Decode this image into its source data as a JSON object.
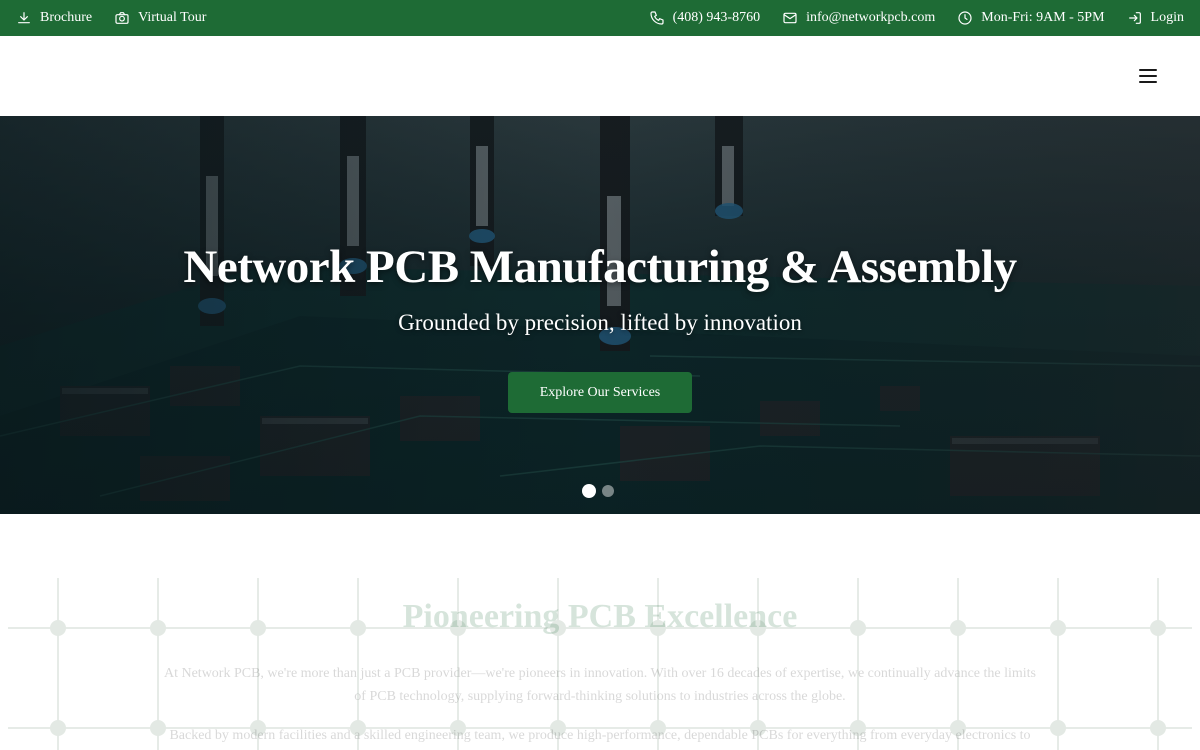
{
  "topbar": {
    "brochure": "Brochure",
    "virtual_tour": "Virtual Tour",
    "phone": "(408) 943-8760",
    "email": "info@networkpcb.com",
    "hours": "Mon-Fri: 9AM - 5PM",
    "login": "Login"
  },
  "hero": {
    "title": "Network PCB Manufacturing & Assembly",
    "subtitle": "Grounded by precision, lifted by innovation",
    "cta": "Explore Our Services",
    "slides": 2,
    "active_slide": 1
  },
  "section": {
    "title": "Pioneering PCB Excellence",
    "paragraph1": "At Network PCB, we're more than just a PCB provider—we're pioneers in innovation. With over 16 decades of expertise, we continually advance the limits of PCB technology, supplying forward-thinking solutions to industries across the globe.",
    "paragraph2": "Backed by modern facilities and a skilled engineering team, we produce high-performance, dependable PCBs for everything from everyday electronics to"
  },
  "colors": {
    "brand_green": "#1e6b35",
    "white": "#ffffff"
  },
  "icons": [
    "download-icon",
    "camera-icon",
    "phone-icon",
    "mail-icon",
    "clock-icon",
    "login-icon",
    "hamburger-menu-icon"
  ]
}
